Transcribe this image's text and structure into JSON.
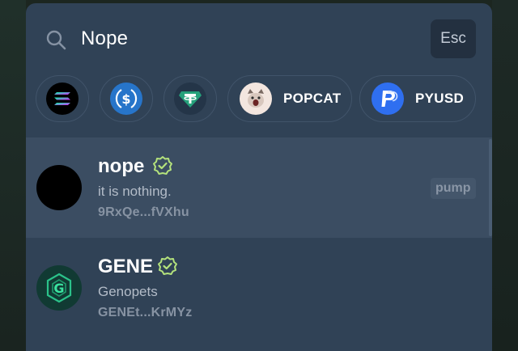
{
  "search": {
    "query": "Nope",
    "esc_label": "Esc"
  },
  "chips": [
    {
      "name": "solana",
      "label": "",
      "icon": "solana-icon"
    },
    {
      "name": "usdc",
      "label": "",
      "icon": "usdc-icon"
    },
    {
      "name": "usdt",
      "label": "",
      "icon": "tether-icon"
    },
    {
      "name": "popcat",
      "label": "POPCAT",
      "icon": "popcat-avatar"
    },
    {
      "name": "pyusd",
      "label": "PYUSD",
      "icon": "pyusd-icon"
    }
  ],
  "results": [
    {
      "name": "nope",
      "description": "it is nothing.",
      "address": "9RxQe...fVXhu",
      "badge": "pump",
      "verified": true
    },
    {
      "name": "GENE",
      "description": "Genopets",
      "address": "GENEt...KrMYz",
      "verified": true
    }
  ],
  "colors": {
    "panel": "#304256",
    "highlight": "#3b4d62",
    "verified": "#b4e27c",
    "pyusd": "#2f6ff0",
    "usdc": "#2775ca",
    "tether": "#26a17b"
  }
}
